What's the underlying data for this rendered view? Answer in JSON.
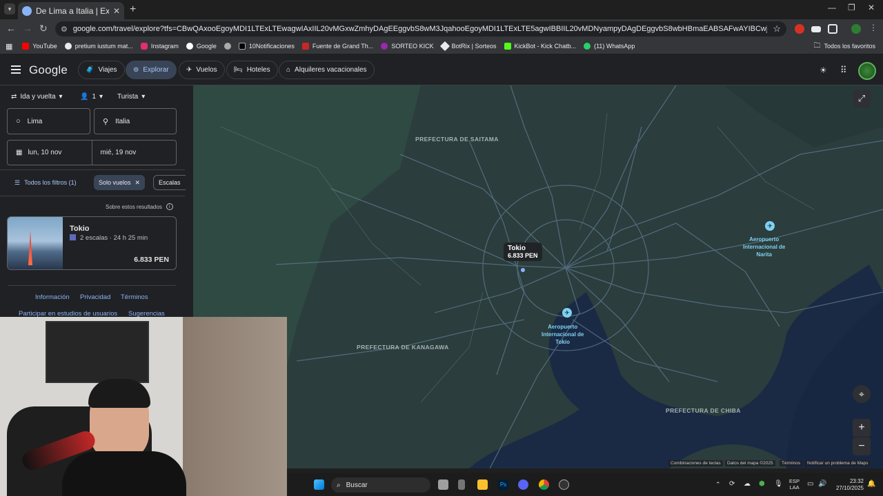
{
  "browser": {
    "tab_title": "De Lima a Italia | Explorar",
    "url": "google.com/travel/explore?tfs=CBwQAxooEgoyMDI1LTExLTEwagwIAxIIL20vMGxwZmhyDAgEEggvbS8wM3JqahooEgoyMDI1LTExLTE5agwIBBIIL20vMDNyampyDAgDEggvbS8wbHBmaEABSAFwAYIBCwj_________8BmAEBsgEEGAEgAQ&tfu=Gioa...",
    "bookmarks": [
      "YouTube",
      "pretium iustum mat...",
      "Instagram",
      "Google",
      "",
      "10Notificaciones",
      "Fuente de Grand Th...",
      "SORTEO KICK",
      "BotRix | Sorteos",
      "KickBot - Kick Chatb...",
      "(11) WhatsApp"
    ],
    "all_favorites": "Todos los favoritos"
  },
  "header": {
    "logo": "Google",
    "nav": [
      "Viajes",
      "Explorar",
      "Vuelos",
      "Hoteles",
      "Alquileres vacacionales"
    ],
    "active": "Explorar"
  },
  "search": {
    "trip_type": "Ida y vuelta",
    "passengers": "1",
    "cabin": "Turista",
    "origin": "Lima",
    "destination": "Italia",
    "depart": "lun, 10 nov",
    "return": "mié, 19 nov"
  },
  "filters": {
    "all": "Todos los filtros (1)",
    "only_flights": "Solo vuelos",
    "stops": "Escalas"
  },
  "results": {
    "about": "Sobre estos resultados",
    "card": {
      "city": "Tokio",
      "detail": "2 escalas · 24 h 25 min",
      "price": "6.833 PEN"
    }
  },
  "footer": {
    "links": [
      "Información",
      "Privacidad",
      "Términos"
    ],
    "links2": [
      "Participar en estudios de usuarios",
      "Sugerencias"
    ]
  },
  "map": {
    "labels": {
      "saitama": "PREFECTURA DE SAITAMA",
      "kanagawa": "PREFECTURA DE KANAGAWA",
      "chiba": "PREFECTURA DE CHIBA"
    },
    "callout": {
      "city": "Tokio",
      "price": "6.833 PEN"
    },
    "airports": {
      "narita": [
        "Aeropuerto",
        "Internacional de",
        "Narita"
      ],
      "tokyo": [
        "Aeropuerto",
        "Internacional de",
        "Tokio"
      ]
    },
    "attribution": [
      "Combinaciones de teclas",
      "Datos del mapa ©2025",
      "Términos",
      "Notificar un problema de Maps"
    ],
    "zoom_in": "+",
    "zoom_out": "−"
  },
  "taskbar": {
    "search": "Buscar",
    "lang": "ESP",
    "layout": "LAA",
    "time": "23:32",
    "date": "27/10/2025"
  }
}
